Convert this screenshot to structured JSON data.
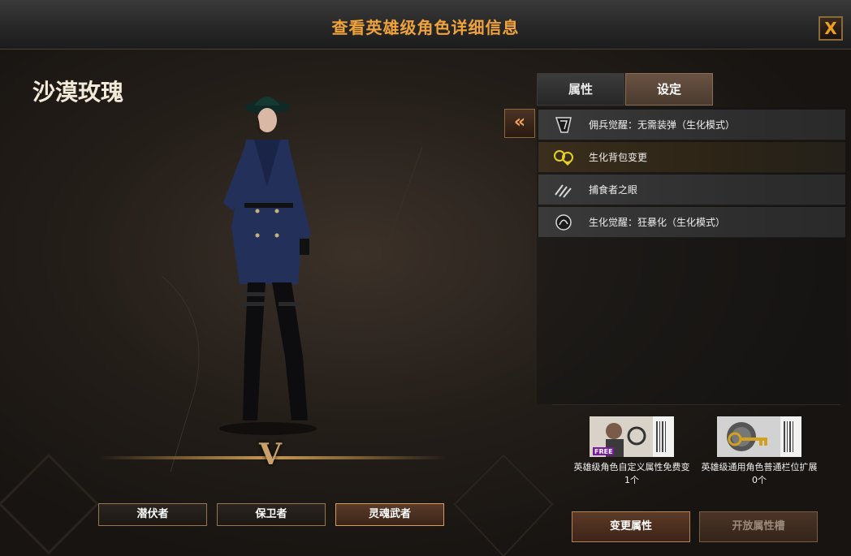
{
  "window": {
    "title": "查看英雄级角色详细信息",
    "close_label": "X"
  },
  "hero": {
    "name": "沙漠玫瑰",
    "rank": "V"
  },
  "classes": [
    {
      "label": "潜伏者",
      "active": false
    },
    {
      "label": "保卫者",
      "active": false
    },
    {
      "label": "灵魂武者",
      "active": true
    }
  ],
  "tabs": [
    {
      "label": "属性",
      "active": false
    },
    {
      "label": "设定",
      "active": true
    }
  ],
  "collapse_label": "«",
  "skills": [
    {
      "label": "佣兵觉醒：无需装弹（生化模式）",
      "icon": "shield-icon",
      "highlighted": false
    },
    {
      "label": "生化背包变更",
      "icon": "biohazard-bag-icon",
      "highlighted": true
    },
    {
      "label": "捕食者之眼",
      "icon": "claw-icon",
      "highlighted": false
    },
    {
      "label": "生化觉醒：狂暴化（生化模式）",
      "icon": "rage-icon",
      "highlighted": false
    }
  ],
  "items": [
    {
      "name": "英雄级角色自定义属性免费变",
      "count": "1个",
      "icon": "free-ticket-icon",
      "badge": "FREE"
    },
    {
      "name": "英雄级通用角色普通栏位扩展",
      "count": "0个",
      "icon": "key-ticket-icon"
    }
  ],
  "actions": {
    "change_label": "变更属性",
    "open_label": "开放属性槽"
  },
  "colors": {
    "title": "#f0a33a",
    "accent_border": "#9a7650"
  }
}
